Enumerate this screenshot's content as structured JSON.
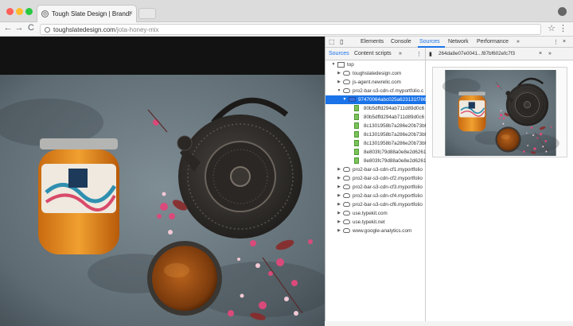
{
  "browser": {
    "tab_title": "Tough Slate Design | Brandi",
    "tab_close": "×",
    "favicon_glyph": "◎",
    "url_domain": "toughslatedesign.com",
    "url_path": "/jota-honey-mix",
    "nav": {
      "back": "←",
      "forward": "→",
      "reload": "C"
    },
    "star": "☆",
    "menu": "⋮",
    "traffic_lights": [
      "#ff5f57",
      "#febc2e",
      "#28c840"
    ]
  },
  "devtools": {
    "tabs": [
      "Elements",
      "Console",
      "Sources",
      "Network",
      "Performance"
    ],
    "active_tab": "Sources",
    "more": "»",
    "close": "×",
    "menu": "⋮",
    "sidebar_tabs": [
      "Sources",
      "Content scripts"
    ],
    "sidebar_more": "»",
    "editor_file": "264da8e07e0041...f87bf602efc7f3",
    "editor_close": "×",
    "editor_more": "»",
    "tree": [
      {
        "label": "top",
        "icon": "frame-icon",
        "arrow": "▼"
      },
      {
        "label": "toughslatedesign.com",
        "icon": "cloud-icon",
        "arrow": "▶"
      },
      {
        "label": "js-agent.newrelic.com",
        "icon": "cloud-icon",
        "arrow": "▶"
      },
      {
        "label": "pro2-bar-s3-cdn-cf.myportfolio.c",
        "icon": "cloud-icon",
        "arrow": "▼"
      },
      {
        "label": "97470064abc025a623131f786",
        "icon": "folder-icon",
        "arrow": "▼",
        "selected": true
      },
      {
        "label": "80b5dffd294ab711d89d0c6",
        "icon": "file-icon"
      },
      {
        "label": "80b5dffd294ab711d89d0c6",
        "icon": "file-icon"
      },
      {
        "label": "8c1301958b7a286e20b73bf",
        "icon": "file-icon"
      },
      {
        "label": "8c1301958b7a286e20b73bf",
        "icon": "file-icon"
      },
      {
        "label": "8c1301958b7a286e20b73bf",
        "icon": "file-icon"
      },
      {
        "label": "8e803fc79d88a0e8e2d6261",
        "icon": "file-icon"
      },
      {
        "label": "8e803fc79d88a0e8e2d6261",
        "icon": "file-icon"
      },
      {
        "label": "pro2-bar-s3-cdn-cf1.myportfolio",
        "icon": "cloud-icon",
        "arrow": "▶"
      },
      {
        "label": "pro2-bar-s3-cdn-cf2.myportfolio",
        "icon": "cloud-icon",
        "arrow": "▶"
      },
      {
        "label": "pro2-bar-s3-cdn-cf3.myportfolio",
        "icon": "cloud-icon",
        "arrow": "▶"
      },
      {
        "label": "pro2-bar-s3-cdn-cf4.myportfolio",
        "icon": "cloud-icon",
        "arrow": "▶"
      },
      {
        "label": "pro2-bar-s3-cdn-cf6.myportfolio",
        "icon": "cloud-icon",
        "arrow": "▶"
      },
      {
        "label": "use.typekit.com",
        "icon": "cloud-icon",
        "arrow": "▶"
      },
      {
        "label": "use.typekit.net",
        "icon": "cloud-icon",
        "arrow": "▶"
      },
      {
        "label": "www.google-analytics.com",
        "icon": "cloud-icon",
        "arrow": "▶"
      }
    ]
  }
}
